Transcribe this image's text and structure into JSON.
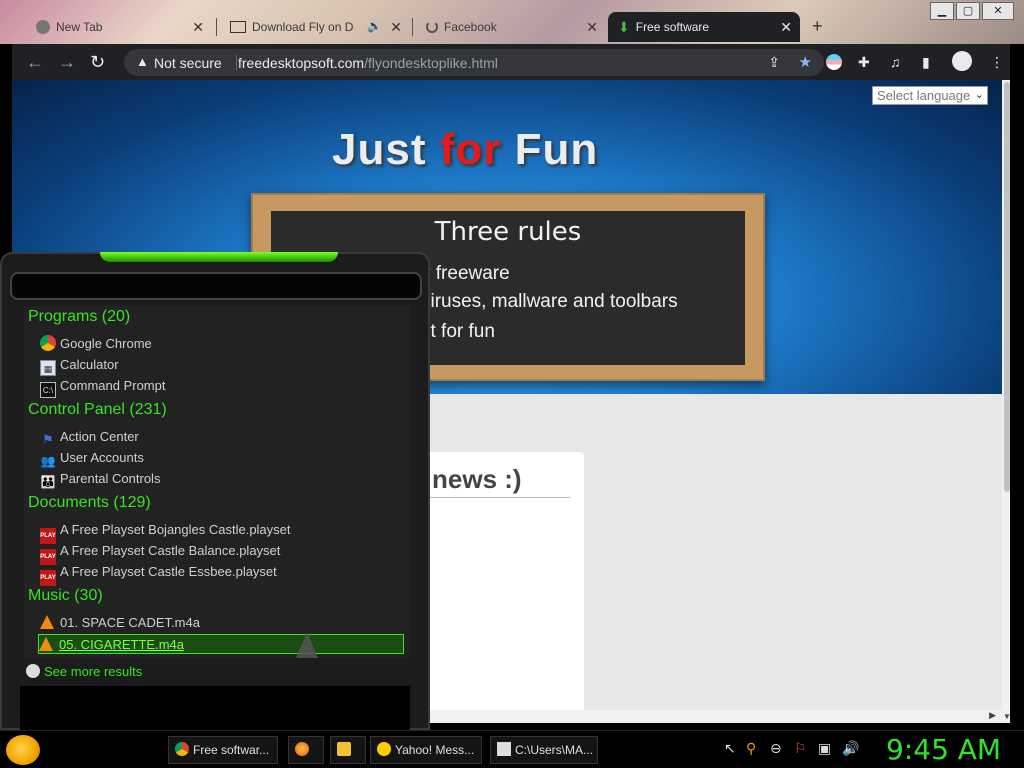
{
  "browser": {
    "tabs": [
      {
        "label": "New Tab",
        "icon": "chrome-icon"
      },
      {
        "label": "Download Fly on D",
        "icon": "keyboard-icon"
      },
      {
        "label": "Facebook",
        "icon": "loading-icon"
      },
      {
        "label": "Free software",
        "icon": "download-arrow-icon"
      }
    ],
    "new_tab": "+",
    "omnibox": {
      "security": "Not secure",
      "domain": "freedesktopsoft.com",
      "path": "/flyondesktoplike.html"
    }
  },
  "page": {
    "language_select": "Select language",
    "title": {
      "word1": "Just",
      "word2": "for",
      "word3": "Fun"
    },
    "board": {
      "title": "Three rules",
      "rules": [
        "y freeware",
        " viruses, mallware and toolbars",
        "st for fun"
      ]
    },
    "card_heading": "news :)"
  },
  "launcher": {
    "categories": [
      {
        "label": "Programs (20)",
        "items": [
          "Google Chrome",
          "Calculator",
          "Command Prompt"
        ]
      },
      {
        "label": "Control Panel (231)",
        "items": [
          "Action Center",
          "User Accounts",
          "Parental Controls"
        ]
      },
      {
        "label": "Documents (129)",
        "items": [
          "A Free Playset Bojangles Castle.playset",
          "A Free Playset Castle Balance.playset",
          "A Free Playset Castle Essbee.playset"
        ]
      },
      {
        "label": "Music (30)",
        "items": [
          "01. SPACE CADET.m4a",
          "05. CIGARETTE.m4a"
        ]
      }
    ],
    "see_more": "See more results",
    "selected_item": "05. CIGARETTE.m4a"
  },
  "taskbar": {
    "tasks": [
      "Free softwar...",
      "Yahoo! Mess...",
      "C:\\Users\\MA..."
    ],
    "clock": "9:45 AM"
  },
  "colors": {
    "accent_green": "#37e51f",
    "title_red": "#e21b1b",
    "hero_blue": "#1d78c7"
  }
}
